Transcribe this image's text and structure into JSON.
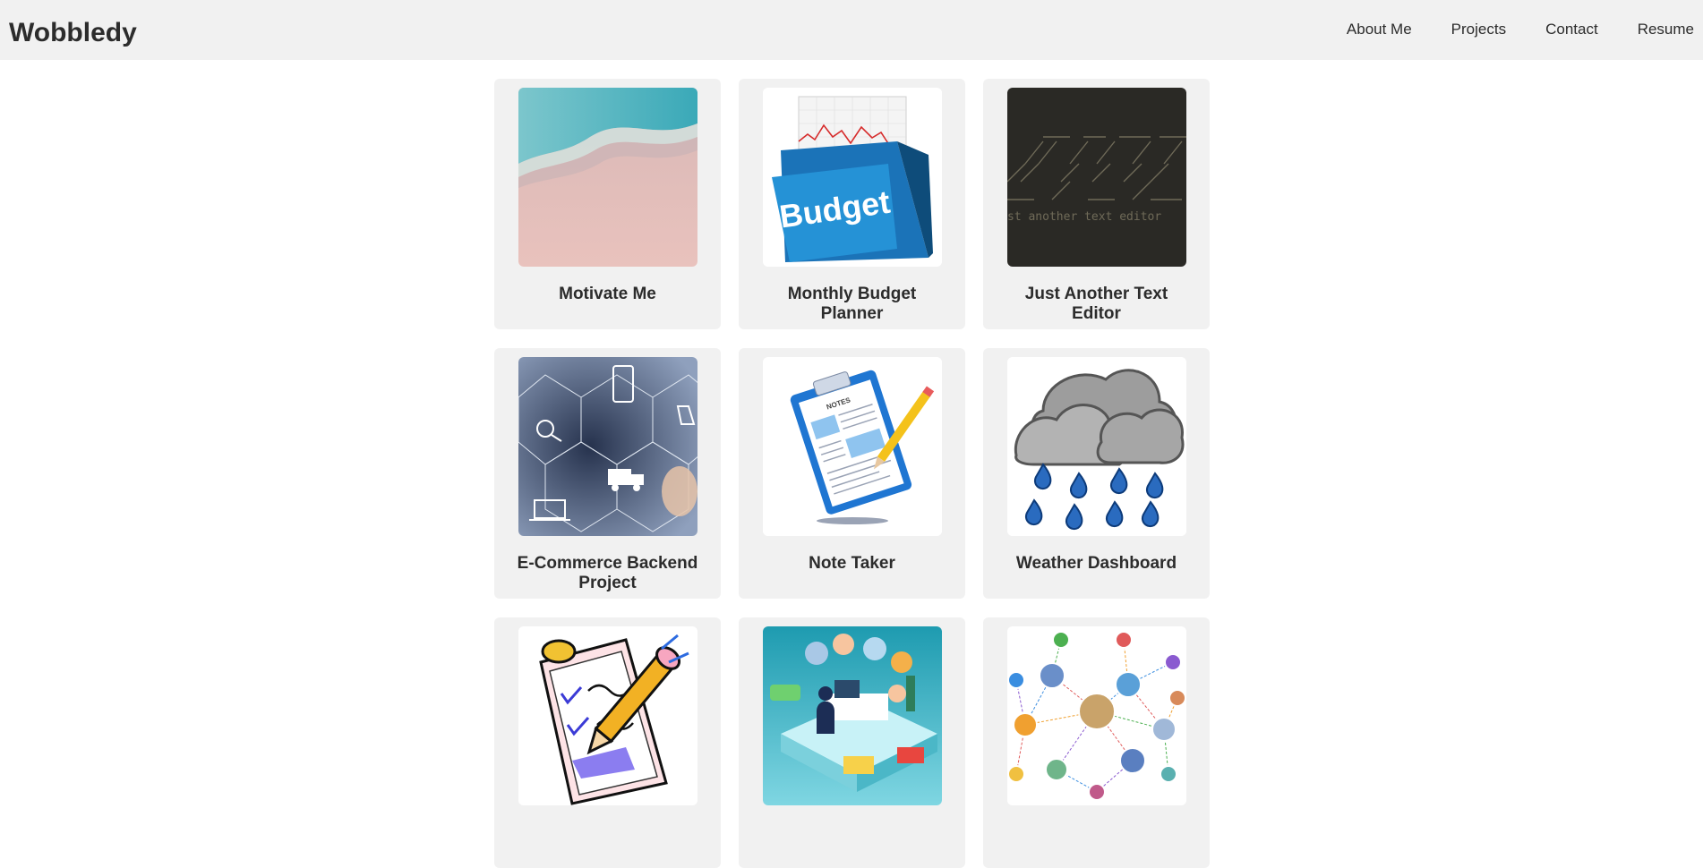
{
  "header": {
    "brand": "Wobbledy",
    "nav": [
      "About Me",
      "Projects",
      "Contact",
      "Resume"
    ]
  },
  "projects": [
    {
      "title": "Motivate Me",
      "image": "beach-shoreline"
    },
    {
      "title": "Monthly Budget Planner",
      "image": "budget-folder"
    },
    {
      "title": "Just Another Text Editor",
      "image": "jate-ascii-logo",
      "image_text": "st another text editor"
    },
    {
      "title": "E-Commerce Backend Project",
      "image": "ecommerce-hexagons"
    },
    {
      "title": "Note Taker",
      "image": "clipboard-notes",
      "image_text": "NOTES"
    },
    {
      "title": "Weather Dashboard",
      "image": "rain-clouds"
    },
    {
      "title": "",
      "image": "clipboard-pencil"
    },
    {
      "title": "",
      "image": "office-team-isometric"
    },
    {
      "title": "",
      "image": "social-network"
    }
  ],
  "colors": {
    "header_bg": "#f1f1f1",
    "card_bg": "#f1f1f1",
    "text": "#2c2c2c"
  }
}
